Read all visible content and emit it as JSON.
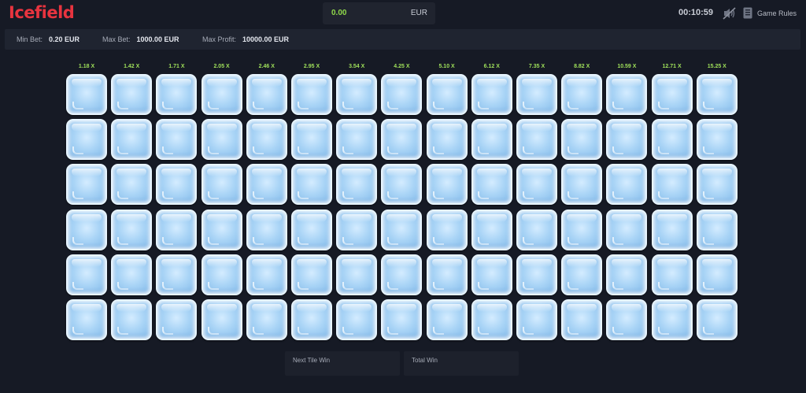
{
  "app": {
    "title": "Icefield"
  },
  "balance": {
    "amount": "0.00",
    "currency": "EUR"
  },
  "header": {
    "time": "00:10:59",
    "rules_label": "Game Rules",
    "sound_icon": "sound-muted-icon",
    "rules_icon": "rules-book-icon"
  },
  "limits": {
    "min_bet_label": "Min Bet:",
    "min_bet_value": "0.20 EUR",
    "max_bet_label": "Max Bet:",
    "max_bet_value": "1000.00 EUR",
    "max_profit_label": "Max Profit:",
    "max_profit_value": "10000.00 EUR"
  },
  "board": {
    "rows": 6,
    "multipliers": [
      "1.18 X",
      "1.42 X",
      "1.71 X",
      "2.05 X",
      "2.46 X",
      "2.95 X",
      "3.54 X",
      "4.25 X",
      "5.10 X",
      "6.12 X",
      "7.35 X",
      "8.82 X",
      "10.59 X",
      "12.71 X",
      "15.25 X"
    ]
  },
  "wins": {
    "next_tile_label": "Next Tile Win",
    "total_label": "Total Win"
  },
  "colors": {
    "brand": "#e8343f",
    "balance": "#8fd94a",
    "multiplier": "#9fe05a",
    "background": "#161a25"
  }
}
